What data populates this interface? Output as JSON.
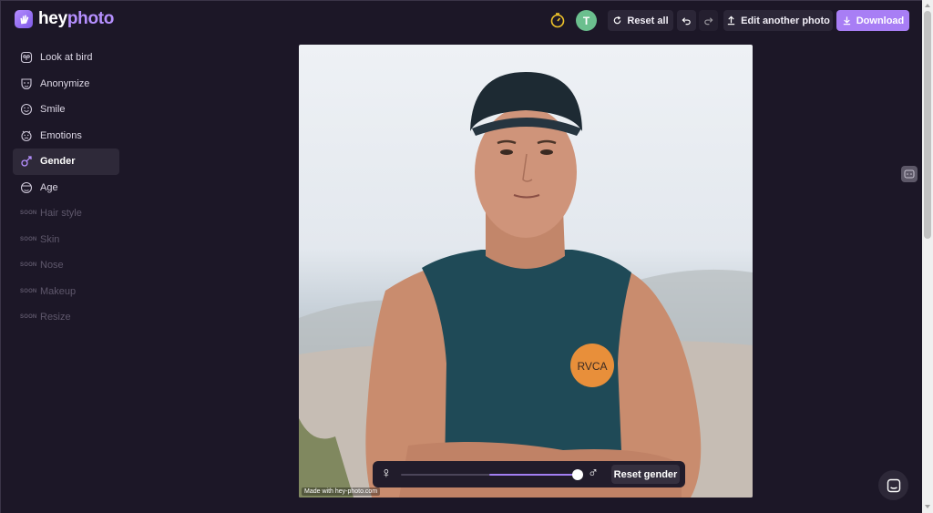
{
  "header": {
    "logo_hey": "hey",
    "logo_photo": "photo",
    "avatar_initial": "T",
    "reset_all_label": "Reset all",
    "edit_another_label": "Edit another photo",
    "download_label": "Download"
  },
  "sidebar": {
    "items": [
      {
        "label": "Look at bird",
        "icon": "bird-eye-icon",
        "state": "normal"
      },
      {
        "label": "Anonymize",
        "icon": "mask-icon",
        "state": "normal"
      },
      {
        "label": "Smile",
        "icon": "smile-icon",
        "state": "normal"
      },
      {
        "label": "Emotions",
        "icon": "emotion-face-icon",
        "state": "normal"
      },
      {
        "label": "Gender",
        "icon": "gender-icon",
        "state": "active"
      },
      {
        "label": "Age",
        "icon": "age-face-icon",
        "state": "normal"
      },
      {
        "label": "Hair style",
        "badge": "SOON",
        "state": "soon"
      },
      {
        "label": "Skin",
        "badge": "SOON",
        "state": "soon"
      },
      {
        "label": "Nose",
        "badge": "SOON",
        "state": "soon"
      },
      {
        "label": "Makeup",
        "badge": "SOON",
        "state": "soon"
      },
      {
        "label": "Resize",
        "badge": "SOON",
        "state": "soon"
      }
    ]
  },
  "canvas": {
    "watermark": "Made with hey-photo.com",
    "shirt_logo_text": "RVCA"
  },
  "gender_slider": {
    "female_symbol": "♀",
    "male_symbol": "♂",
    "value": 1.0,
    "reset_label": "Reset gender"
  },
  "colors": {
    "background": "#1c1727",
    "accent": "#a87ef5",
    "button": "#2b2637"
  }
}
